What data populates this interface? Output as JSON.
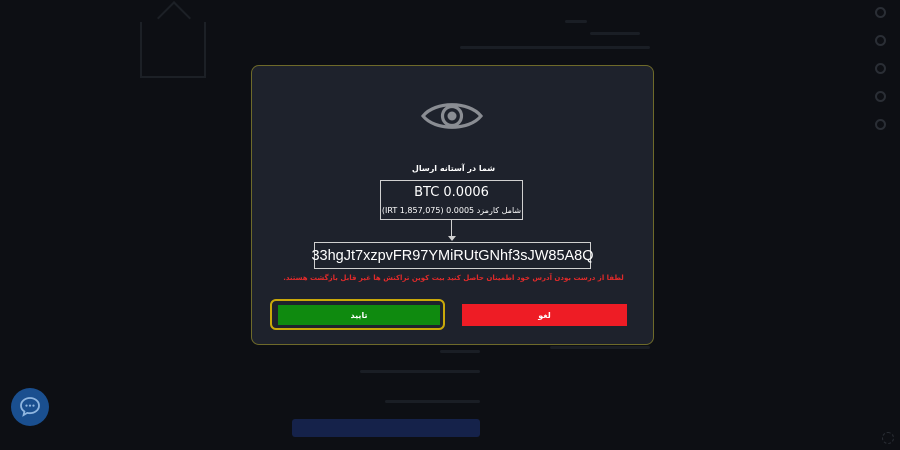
{
  "modal": {
    "eye_icon": "eye-icon",
    "title": "شما در آستانه ارسال",
    "amount": "BTC 0.0006",
    "fee": "شامل کارمزد 0.0005 (IRT 1,857,075)",
    "address": "33hgJt7xzpvFR97YMiRUtGNhf3sJW85A8Q",
    "warning": "لطفا از درست بودن آدرس خود اطمینان حاصل کنید بیت کوین تراکنش ها غیر قابل بازگشت هستند.",
    "confirm_label": "تایید",
    "cancel_label": "لغو"
  },
  "colors": {
    "modal_bg": "#1e222c",
    "modal_border": "#6e6a2a",
    "confirm": "#0f8a0f",
    "confirm_focus_ring": "#c9a80a",
    "cancel": "#ee1c25",
    "warning": "#e12a2a"
  },
  "chat_button": {
    "icon": "chat-bubble-icon"
  }
}
